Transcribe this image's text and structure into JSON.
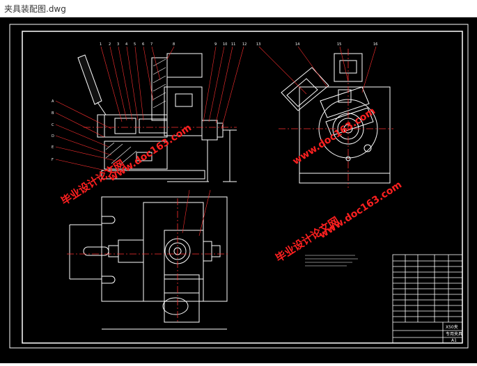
{
  "window": {
    "title": "夹具装配图.dwg"
  },
  "drawing": {
    "watermark_cn": "毕业设计论文网",
    "watermark_url": "www.doc163.com",
    "part_numbers_top": [
      "1",
      "2",
      "3",
      "4",
      "5",
      "6",
      "7",
      "8",
      "9",
      "10",
      "11",
      "12"
    ],
    "part_numbers_right": [
      "13",
      "14",
      "15",
      "16"
    ],
    "part_numbers_left": [
      "A",
      "B",
      "C",
      "D",
      "E",
      "F"
    ],
    "title_block": {
      "drawing_name": "X50夹",
      "school": "专用夹具",
      "sheet_size": "A1"
    }
  },
  "colors": {
    "background": "#000000",
    "frame": "#ffffff",
    "leader": "#ff3030",
    "centerline": "#ff3030",
    "watermark": "#ff2020"
  }
}
